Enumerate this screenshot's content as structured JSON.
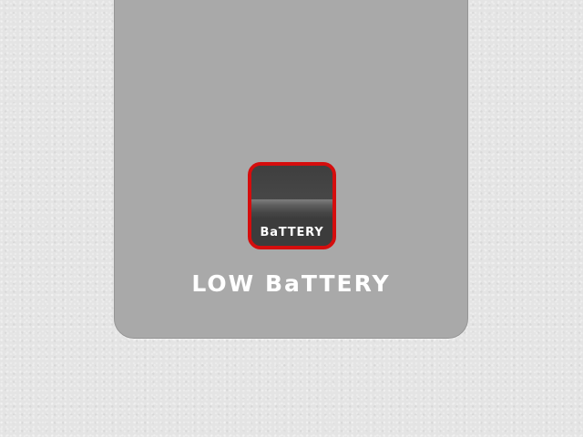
{
  "battery_icon": {
    "label": "BaTTERY",
    "border_color": "#d50d0d"
  },
  "status": {
    "message": "LOW BaTTERY"
  },
  "colors": {
    "background": "#e4e4e4",
    "panel": "#a9a9a9",
    "text": "#ffffff"
  }
}
